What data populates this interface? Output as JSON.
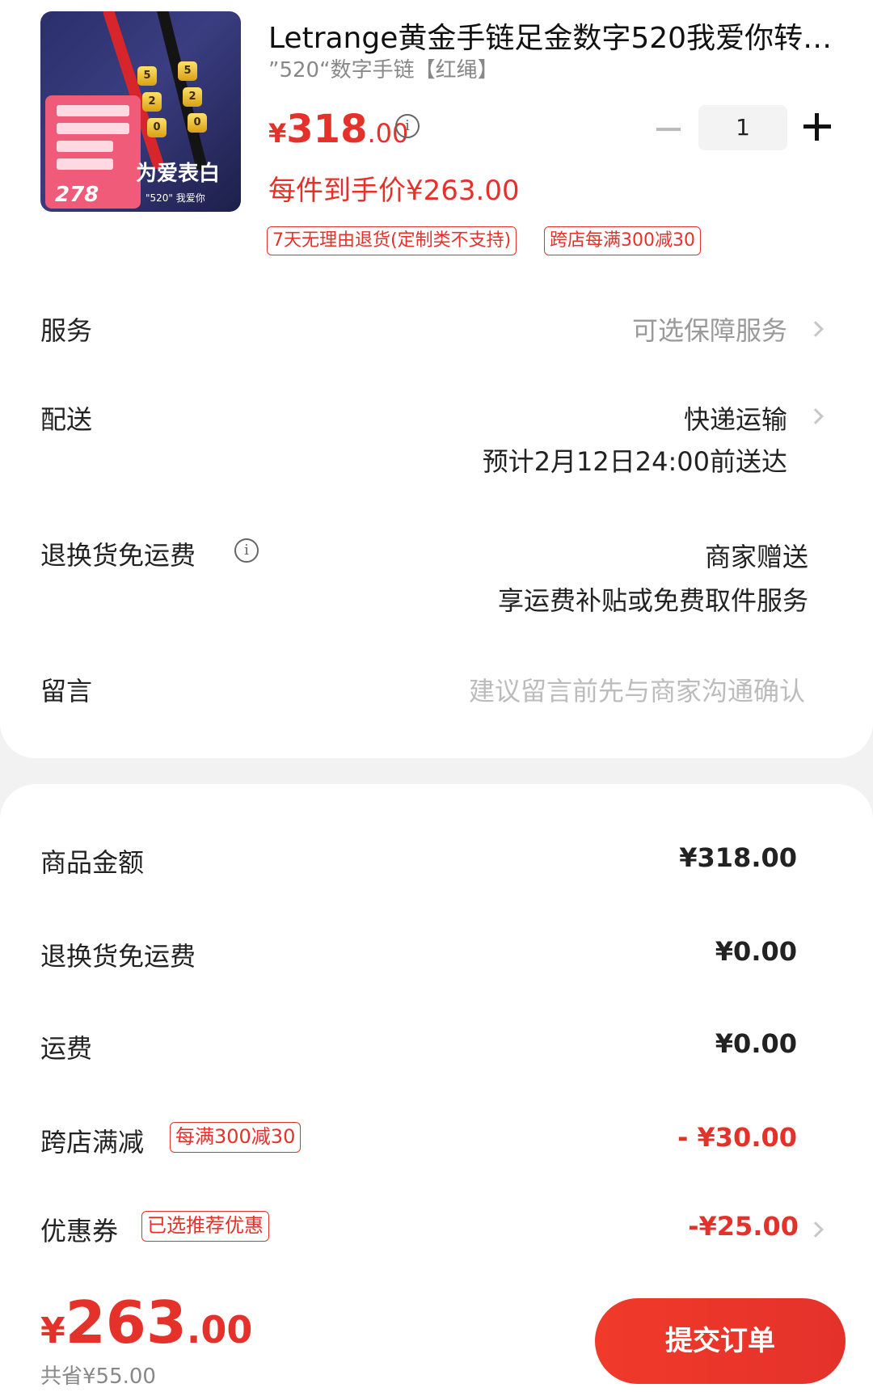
{
  "product": {
    "title": "Letrange黄金手链足金数字520我爱你转…",
    "variant": "”520“数字手链【红绳】",
    "price_symbol": "¥",
    "price_int": "318",
    "price_dec": ".00",
    "hand_price": "每件到手价¥263.00",
    "quantity": "1",
    "tags": [
      "7天无理由退货(定制类不支持)",
      "跨店每满300减30"
    ],
    "thumb_promo_price": "278",
    "thumb_text": "为爱表白",
    "thumb_sub": "\"520\" 我爱你"
  },
  "options": {
    "service_label": "服务",
    "service_value": "可选保障服务",
    "delivery_label": "配送",
    "delivery_value": "快递运输",
    "delivery_eta": "预计2月12日24:00前送达",
    "return_label": "退换货免运费",
    "return_value": "商家赠送",
    "return_desc": "享运费补贴或免费取件服务",
    "message_label": "留言",
    "message_placeholder": "建议留言前先与商家沟通确认"
  },
  "summary": {
    "goods_label": "商品金额",
    "goods_value": "¥318.00",
    "return_fee_label": "退换货免运费",
    "return_fee_value": "¥0.00",
    "shipping_label": "运费",
    "shipping_value": "¥0.00",
    "cross_store_label": "跨店满减",
    "cross_store_tag": "每满300减30",
    "cross_store_value": "- ¥30.00",
    "coupon_label": "优惠券",
    "coupon_tag": "已选推荐优惠",
    "coupon_value": "-¥25.00"
  },
  "footer": {
    "total_symbol": "¥",
    "total_int": "263",
    "total_dec": ".00",
    "saved": "共省¥55.00",
    "submit_label": "提交订单"
  },
  "colors": {
    "accent": "#e4322b",
    "muted": "#999999"
  }
}
